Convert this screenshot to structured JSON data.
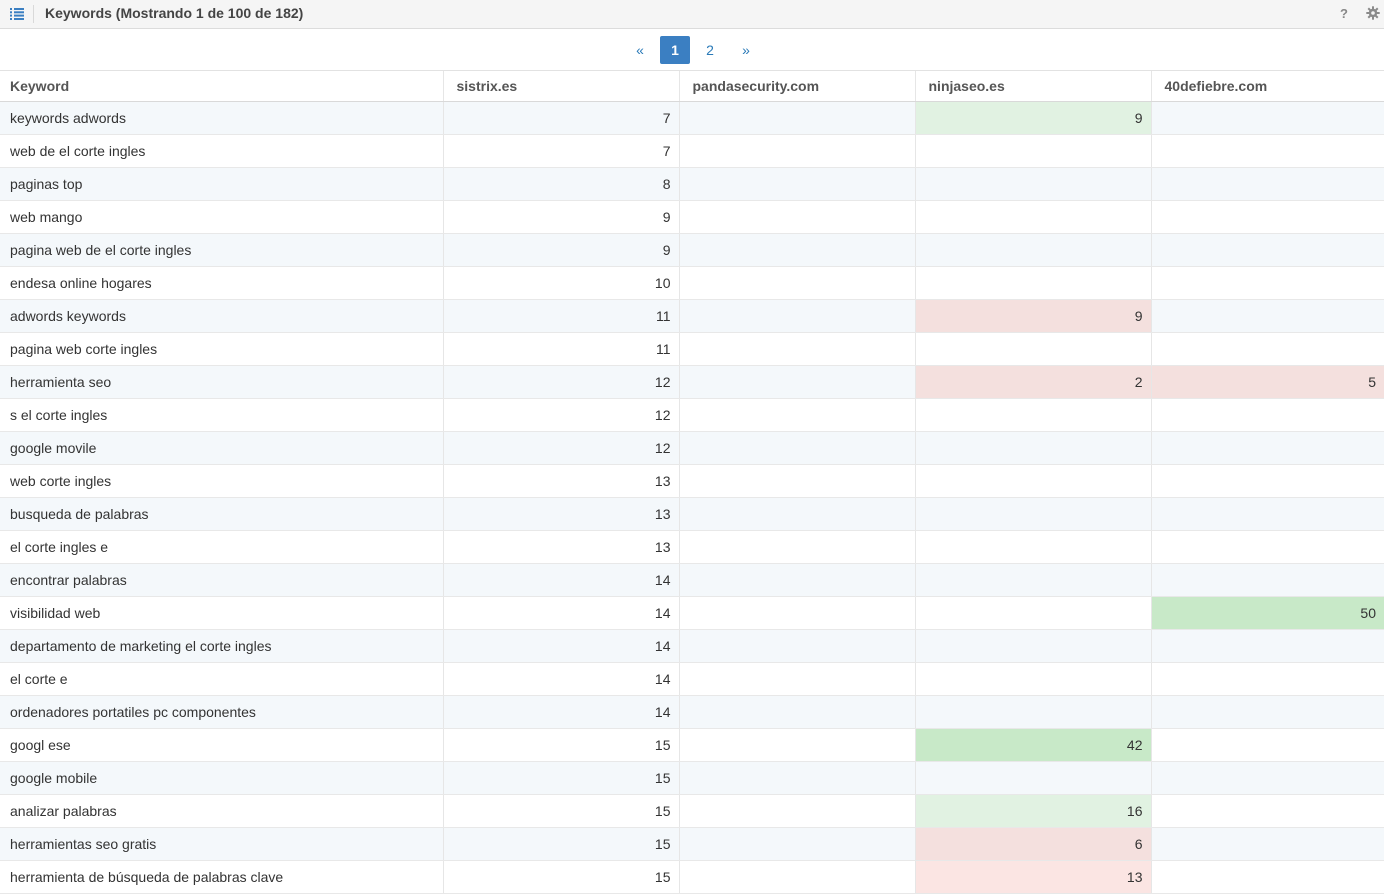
{
  "header": {
    "title": "Keywords (Mostrando 1 de 100 de 182)",
    "help_label": "?"
  },
  "pagination": {
    "prev": "«",
    "pages": [
      "1",
      "2"
    ],
    "current": "1",
    "next": "»"
  },
  "table": {
    "columns": [
      "Keyword",
      "sistrix.es",
      "pandasecurity.com",
      "ninjaseo.es",
      "40defiebre.com"
    ],
    "rows": [
      {
        "keyword": "keywords adwords",
        "sistrix": "7",
        "panda": "",
        "ninja": "9",
        "fiebre": ""
      },
      {
        "keyword": "web de el corte ingles",
        "sistrix": "7",
        "panda": "",
        "ninja": "",
        "fiebre": ""
      },
      {
        "keyword": "paginas top",
        "sistrix": "8",
        "panda": "",
        "ninja": "",
        "fiebre": ""
      },
      {
        "keyword": "web mango",
        "sistrix": "9",
        "panda": "",
        "ninja": "",
        "fiebre": ""
      },
      {
        "keyword": "pagina web de el corte ingles",
        "sistrix": "9",
        "panda": "",
        "ninja": "",
        "fiebre": ""
      },
      {
        "keyword": "endesa online hogares",
        "sistrix": "10",
        "panda": "",
        "ninja": "",
        "fiebre": ""
      },
      {
        "keyword": "adwords keywords",
        "sistrix": "11",
        "panda": "",
        "ninja": "9",
        "fiebre": ""
      },
      {
        "keyword": "pagina web corte ingles",
        "sistrix": "11",
        "panda": "",
        "ninja": "",
        "fiebre": ""
      },
      {
        "keyword": "herramienta seo",
        "sistrix": "12",
        "panda": "",
        "ninja": "2",
        "fiebre": "5"
      },
      {
        "keyword": "s el corte ingles",
        "sistrix": "12",
        "panda": "",
        "ninja": "",
        "fiebre": ""
      },
      {
        "keyword": "google movile",
        "sistrix": "12",
        "panda": "",
        "ninja": "",
        "fiebre": ""
      },
      {
        "keyword": "web corte ingles",
        "sistrix": "13",
        "panda": "",
        "ninja": "",
        "fiebre": ""
      },
      {
        "keyword": "busqueda de palabras",
        "sistrix": "13",
        "panda": "",
        "ninja": "",
        "fiebre": ""
      },
      {
        "keyword": "el corte ingles e",
        "sistrix": "13",
        "panda": "",
        "ninja": "",
        "fiebre": ""
      },
      {
        "keyword": "encontrar palabras",
        "sistrix": "14",
        "panda": "",
        "ninja": "",
        "fiebre": ""
      },
      {
        "keyword": "visibilidad web",
        "sistrix": "14",
        "panda": "",
        "ninja": "",
        "fiebre": "50"
      },
      {
        "keyword": "departamento de marketing el corte ingles",
        "sistrix": "14",
        "panda": "",
        "ninja": "",
        "fiebre": ""
      },
      {
        "keyword": "el corte e",
        "sistrix": "14",
        "panda": "",
        "ninja": "",
        "fiebre": ""
      },
      {
        "keyword": "ordenadores portatiles pc componentes",
        "sistrix": "14",
        "panda": "",
        "ninja": "",
        "fiebre": ""
      },
      {
        "keyword": "googl ese",
        "sistrix": "15",
        "panda": "",
        "ninja": "42",
        "fiebre": ""
      },
      {
        "keyword": "google mobile",
        "sistrix": "15",
        "panda": "",
        "ninja": "",
        "fiebre": ""
      },
      {
        "keyword": "analizar palabras",
        "sistrix": "15",
        "panda": "",
        "ninja": "16",
        "fiebre": ""
      },
      {
        "keyword": "herramientas seo gratis",
        "sistrix": "15",
        "panda": "",
        "ninja": "6",
        "fiebre": ""
      },
      {
        "keyword": "herramienta de búsqueda de palabras clave",
        "sistrix": "15",
        "panda": "",
        "ninja": "13",
        "fiebre": ""
      }
    ],
    "highlights": {
      "0.ninja": "hl-green",
      "6.ninja": "hl-red",
      "8.ninja": "hl-red",
      "8.fiebre": "hl-red",
      "15.fiebre": "hl-green2",
      "19.ninja": "hl-green2",
      "21.ninja": "hl-green",
      "22.ninja": "hl-red",
      "23.ninja": "hl-red2"
    }
  },
  "colors": {
    "accent": "#3b7fc2",
    "better": "#e1f2e2",
    "worse": "#f4e0de"
  },
  "icons": {
    "list": "list-icon",
    "help": "help-icon",
    "settings": "gear-icon"
  }
}
